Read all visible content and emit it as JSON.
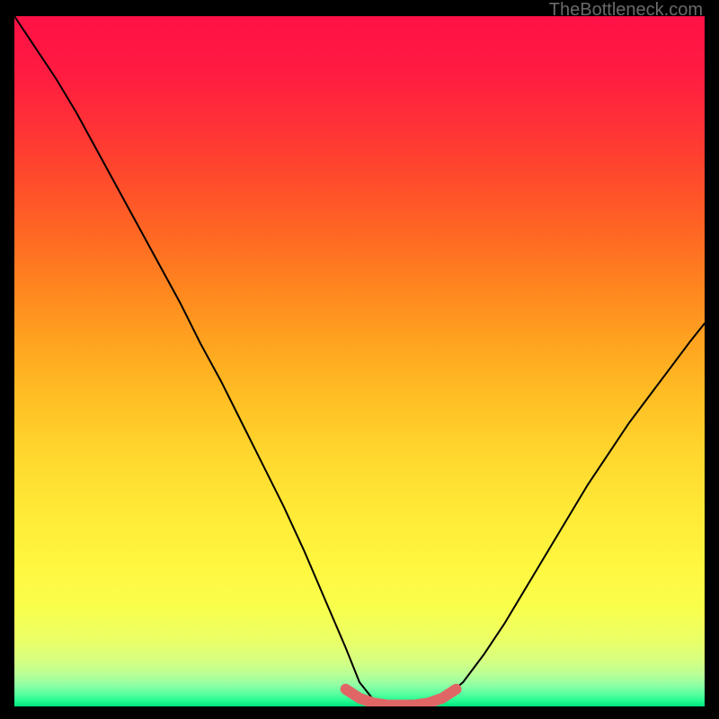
{
  "watermark": "TheBottleneck.com",
  "chart_data": {
    "type": "line",
    "title": "",
    "xlabel": "",
    "ylabel": "",
    "xlim": [
      0,
      100
    ],
    "ylim": [
      0,
      100
    ],
    "grid": false,
    "legend": false,
    "x": [
      0,
      3,
      6,
      9,
      12,
      15,
      18,
      21,
      24,
      27,
      30,
      33,
      36,
      39,
      42,
      45,
      48,
      50,
      52,
      54,
      56,
      58,
      60,
      62,
      65,
      68,
      71,
      74,
      77,
      80,
      83,
      86,
      89,
      92,
      95,
      98,
      100
    ],
    "values": [
      100,
      95.5,
      91,
      86,
      80.5,
      75,
      69.5,
      64,
      58.5,
      52.5,
      47,
      41,
      35,
      29,
      22.5,
      15.5,
      8.5,
      3.5,
      1,
      0,
      0,
      0,
      0,
      1,
      3.5,
      7.5,
      12,
      17,
      22,
      27,
      32,
      36.5,
      41,
      45,
      49,
      53,
      55.5
    ],
    "highlight_segment": {
      "x": [
        48,
        50,
        52,
        54,
        56,
        58,
        60,
        62,
        64
      ],
      "values": [
        2.5,
        1.2,
        0.5,
        0.2,
        0.2,
        0.2,
        0.5,
        1.2,
        2.5
      ],
      "color": "#e06666"
    },
    "background_gradient": {
      "stops": [
        {
          "offset": 0.0,
          "color": "#ff1146"
        },
        {
          "offset": 0.08,
          "color": "#ff1b41"
        },
        {
          "offset": 0.16,
          "color": "#ff3236"
        },
        {
          "offset": 0.24,
          "color": "#ff4c2b"
        },
        {
          "offset": 0.32,
          "color": "#ff6923"
        },
        {
          "offset": 0.4,
          "color": "#ff881f"
        },
        {
          "offset": 0.48,
          "color": "#ffa620"
        },
        {
          "offset": 0.56,
          "color": "#ffc125"
        },
        {
          "offset": 0.64,
          "color": "#ffd82e"
        },
        {
          "offset": 0.72,
          "color": "#ffea37"
        },
        {
          "offset": 0.8,
          "color": "#fff740"
        },
        {
          "offset": 0.86,
          "color": "#f8ff4d"
        },
        {
          "offset": 0.905,
          "color": "#eaff67"
        },
        {
          "offset": 0.935,
          "color": "#d5ff82"
        },
        {
          "offset": 0.955,
          "color": "#b6ff98"
        },
        {
          "offset": 0.97,
          "color": "#8cffa4"
        },
        {
          "offset": 0.982,
          "color": "#58ff9f"
        },
        {
          "offset": 0.992,
          "color": "#22fb91"
        },
        {
          "offset": 1.0,
          "color": "#00e37c"
        }
      ]
    }
  }
}
